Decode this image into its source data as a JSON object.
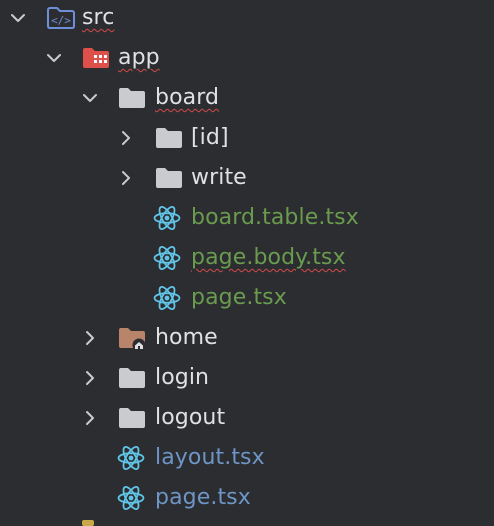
{
  "tree": {
    "nodes": [
      {
        "label": "src",
        "icon": "source-folder-icon",
        "kind": "source-root",
        "expanded": true,
        "misspelled": true,
        "color": "default"
      },
      {
        "label": "app",
        "icon": "app-folder-icon",
        "kind": "folder",
        "expanded": true,
        "misspelled": true,
        "color": "default"
      },
      {
        "label": "board",
        "icon": "folder-icon",
        "kind": "folder",
        "expanded": true,
        "misspelled": true,
        "color": "default"
      },
      {
        "label": "[id]",
        "icon": "folder-icon",
        "kind": "folder",
        "expanded": false,
        "misspelled": false,
        "color": "default"
      },
      {
        "label": "write",
        "icon": "folder-icon",
        "kind": "folder",
        "expanded": false,
        "misspelled": false,
        "color": "default"
      },
      {
        "label": "board.table.tsx",
        "icon": "react-icon",
        "kind": "file",
        "misspelled": false,
        "color": "green"
      },
      {
        "label": "page.body.tsx",
        "icon": "react-icon",
        "kind": "file",
        "misspelled": true,
        "color": "green"
      },
      {
        "label": "page.tsx",
        "icon": "react-icon",
        "kind": "file",
        "misspelled": false,
        "color": "green"
      },
      {
        "label": "home",
        "icon": "home-folder-icon",
        "kind": "folder",
        "expanded": false,
        "misspelled": false,
        "color": "default"
      },
      {
        "label": "login",
        "icon": "folder-icon",
        "kind": "folder",
        "expanded": false,
        "misspelled": false,
        "color": "default"
      },
      {
        "label": "logout",
        "icon": "folder-icon",
        "kind": "folder",
        "expanded": false,
        "misspelled": false,
        "color": "default"
      },
      {
        "label": "layout.tsx",
        "icon": "react-icon",
        "kind": "file",
        "misspelled": false,
        "color": "blue"
      },
      {
        "label": "page.tsx",
        "icon": "react-icon",
        "kind": "file",
        "misspelled": false,
        "color": "blue"
      }
    ]
  },
  "colors": {
    "background": "#2b2d30",
    "text": "#dfe1e5",
    "modified_green": "#6a9b4e",
    "changed_blue": "#6e95c6",
    "react_cyan": "#61c5e8",
    "folder_gray": "#c9cbcf",
    "app_red": "#e0504a",
    "source_blue": "#6e8ed8",
    "home_brown": "#b8846a",
    "spell_red": "#d24a4a"
  }
}
